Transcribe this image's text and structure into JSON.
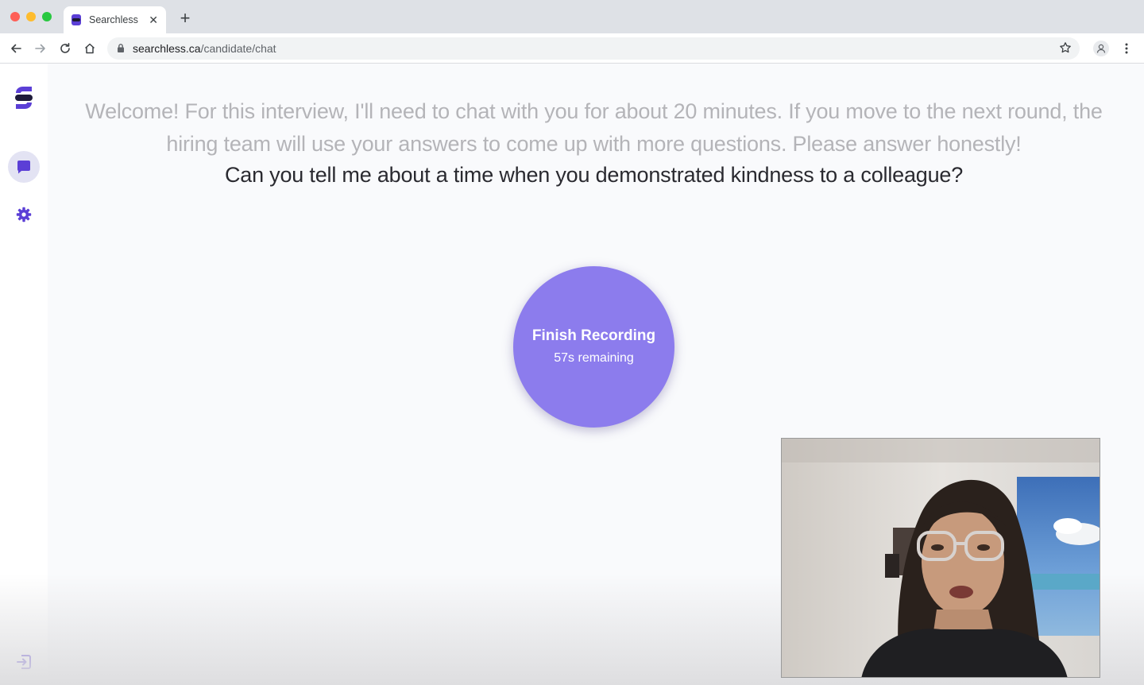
{
  "browser": {
    "tab": {
      "title": "Searchless",
      "close": "✕"
    },
    "new_tab": "+",
    "url_host": "searchless.ca",
    "url_path": "/candidate/chat",
    "colors": {
      "frame": "#dee1e6",
      "omnibox": "#f1f3f4"
    }
  },
  "sidebar": {
    "logo_icon": "searchless-logo-icon",
    "items": [
      {
        "name": "chat",
        "icon": "chat-bubble-icon",
        "active": true
      },
      {
        "name": "settings",
        "icon": "gear-icon",
        "active": false
      }
    ],
    "bottom_icon": "logout-icon"
  },
  "main": {
    "intro": "Welcome! For this interview, I'll need to chat with you for about 20 minutes. If you move to the next round, the hiring team will use your answers to come up with more questions. Please answer honestly!",
    "question": "Can you tell me about a time when you demonstrated kindness to a colleague?",
    "record_button": {
      "label": "Finish Recording",
      "remaining": "57s remaining"
    },
    "colors": {
      "accent": "#8c7ced",
      "brand": "#5b3fd6"
    }
  },
  "video_preview": {
    "description_icon": "webcam-feed"
  }
}
